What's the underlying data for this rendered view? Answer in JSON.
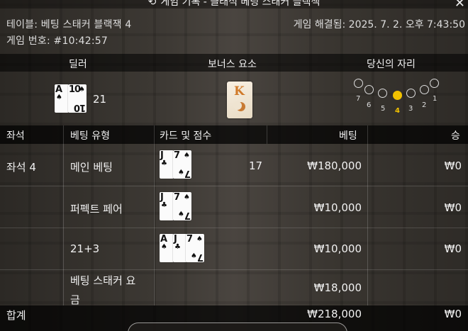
{
  "window": {
    "title": "게임 기록 - 클래식 베팅 스태커 블랙잭",
    "close_icon": "close-icon",
    "history_icon": "clock-history-icon"
  },
  "game_info": {
    "table": "테이블: 베팅 스태커 블랙잭 4",
    "game_number": "게임 번호: #10:42:57",
    "resolved": "게임 해결됨: 2025. 7. 2. 오후 7:43:50"
  },
  "summary": {
    "headers": {
      "dealer": "딜러",
      "bonus": "보너스 요소",
      "your_seat": "당신의 자리"
    },
    "dealer_score": "21",
    "dealer_cards": [
      {
        "rank": "A",
        "suit": "♠"
      },
      {
        "rank": "10",
        "suit": "♠"
      }
    ],
    "bonus_card": {
      "rank": "K"
    },
    "seats": [
      "7",
      "6",
      "5",
      "4",
      "3",
      "2",
      "1"
    ],
    "active_seat": "4",
    "accent_color": "#f2c200"
  },
  "bets_table": {
    "headers": {
      "seat": "좌석",
      "bet_type": "베팅 유형",
      "cards_score": "카드 및 점수",
      "bet": "베팅",
      "win": "승"
    },
    "rows": [
      {
        "seat": "좌석 4",
        "bet_type": "메인 베팅",
        "cards": [
          {
            "rank": "J",
            "suit": "♣"
          },
          {
            "rank": "7",
            "suit": "♠"
          }
        ],
        "score": "17",
        "bet": "₩180,000",
        "win": "₩0"
      },
      {
        "seat": "",
        "bet_type": "퍼펙트 페어",
        "cards": [
          {
            "rank": "J",
            "suit": "♣"
          },
          {
            "rank": "7",
            "suit": "♠"
          }
        ],
        "score": "",
        "bet": "₩10,000",
        "win": "₩0"
      },
      {
        "seat": "",
        "bet_type": "21+3",
        "cards": [
          {
            "rank": "A",
            "suit": "♠"
          },
          {
            "rank": "J",
            "suit": "♣"
          },
          {
            "rank": "7",
            "suit": "♠"
          }
        ],
        "score": "",
        "bet": "₩10,000",
        "win": "₩0"
      },
      {
        "seat": "",
        "bet_type_line1": "베팅 스태커 요",
        "bet_type_line2": "금",
        "cards": [],
        "score": "",
        "bet": "₩18,000",
        "win": ""
      }
    ],
    "total": {
      "label": "합계",
      "bet": "₩218,000",
      "win": "₩0"
    }
  }
}
